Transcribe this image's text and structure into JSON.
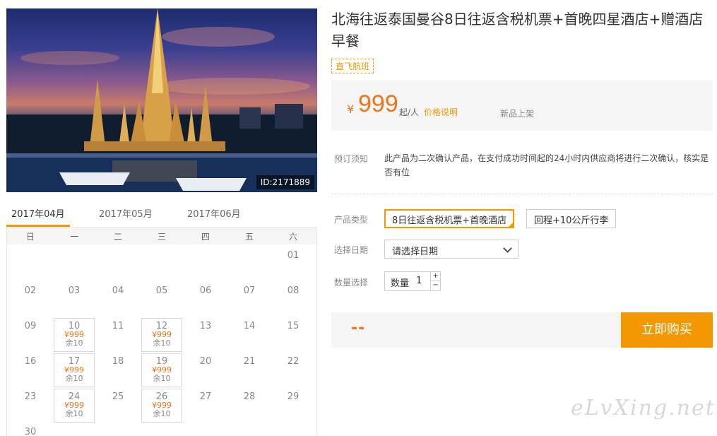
{
  "hero": {
    "id_label": "ID:2171889"
  },
  "calendar": {
    "months": [
      "2017年04月",
      "2017年05月",
      "2017年06月"
    ],
    "weekdays": [
      "日",
      "一",
      "二",
      "三",
      "四",
      "五",
      "六"
    ],
    "plain_days": [
      "01",
      "02",
      "03",
      "04",
      "05",
      "06",
      "07",
      "08",
      "09",
      "11",
      "13",
      "14",
      "15",
      "16",
      "18",
      "20",
      "21",
      "22",
      "23",
      "25",
      "27",
      "28",
      "29",
      "30"
    ],
    "avail_days": [
      {
        "day": "10",
        "price": "¥999",
        "stock": "余10"
      },
      {
        "day": "12",
        "price": "¥999",
        "stock": "余10"
      },
      {
        "day": "17",
        "price": "¥999",
        "stock": "余10"
      },
      {
        "day": "19",
        "price": "¥999",
        "stock": "余10"
      },
      {
        "day": "24",
        "price": "¥999",
        "stock": "余10"
      },
      {
        "day": "26",
        "price": "¥999",
        "stock": "余10"
      }
    ]
  },
  "product": {
    "title": "北海往返泰国曼谷8日往返含税机票+首晚四星酒店+赠酒店早餐",
    "tag": "直飞航班",
    "currency": "¥",
    "price": "999",
    "per": "起/人",
    "price_note": "价格说明",
    "new_badge": "新品上架",
    "booking_label": "预订须知",
    "booking_text": "此产品为二次确认产品，在支付成功时间起的24小时内供应商将进行二次确认，核实是否有位"
  },
  "form": {
    "type_label": "产品类型",
    "type_options": [
      "8日往返含税机票+首晚酒店",
      "回程+10公斤行李"
    ],
    "date_label": "选择日期",
    "date_value": "请选择日期",
    "qty_label": "数量选择",
    "qty_name": "数量",
    "qty_value": "1",
    "plus": "+",
    "minus": "−"
  },
  "buy": {
    "total": "--",
    "button": "立即购买"
  },
  "watermark": "eLvXing.net",
  "colors": {
    "accent": "#f39800",
    "price": "#f0741a"
  }
}
